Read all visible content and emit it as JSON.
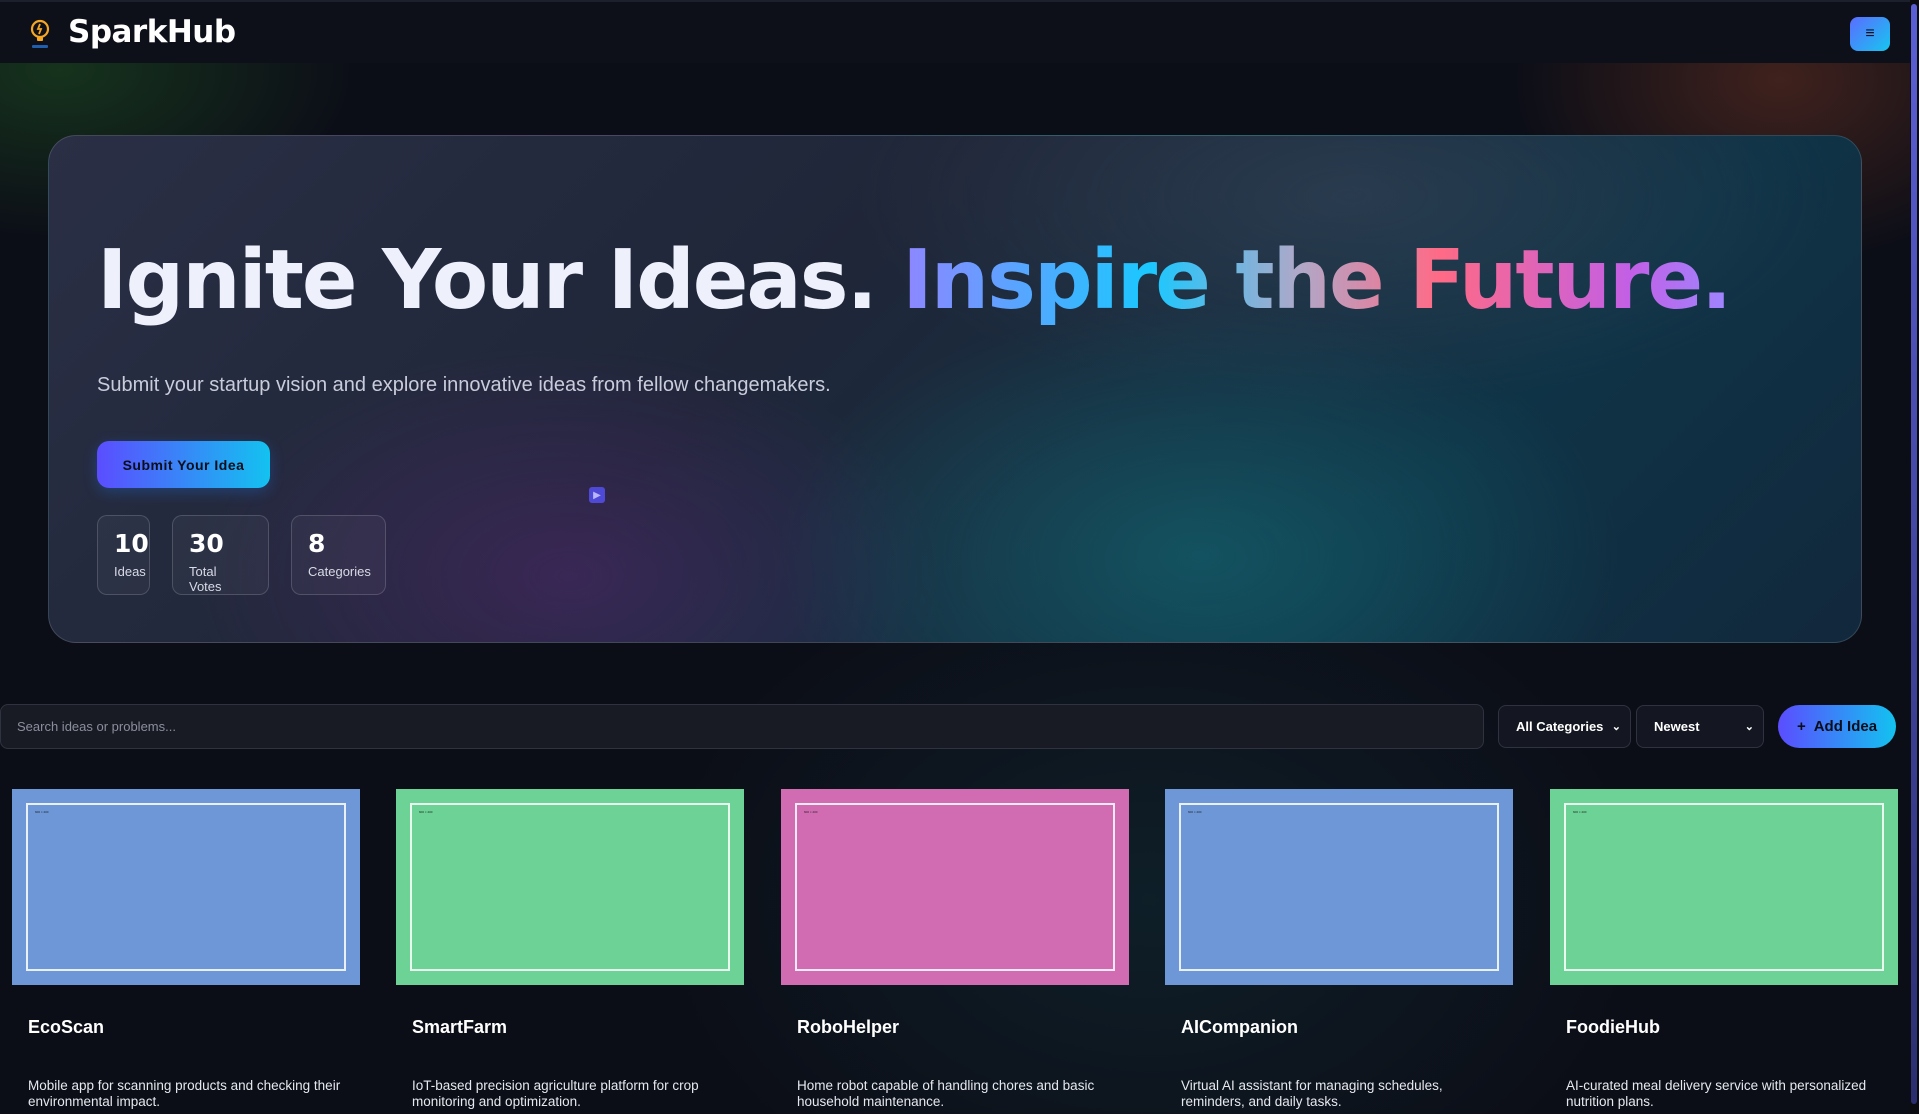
{
  "navbar": {
    "brand": "SparkHub",
    "logo_icon": "lightbulb-icon",
    "menu_icon": "menu-icon",
    "menu_glyph": "≡"
  },
  "hero": {
    "title_plain": "Ignite Your Ideas.",
    "title_gradient": "Inspire the Future.",
    "subtitle": "Submit your startup vision and explore innovative ideas from fellow changemakers.",
    "submit_label": "Submit Your Idea",
    "cursor_icon": "play-icon",
    "stats": [
      {
        "value": "10",
        "label": "Ideas"
      },
      {
        "value": "30",
        "label": "Total Votes"
      },
      {
        "value": "8",
        "label": "Categories"
      }
    ]
  },
  "filters": {
    "search_placeholder": "Search ideas or problems...",
    "category_selected": "All Categories",
    "sort_selected": "Newest",
    "add_label": "Add Idea",
    "add_icon": "plus-icon",
    "add_glyph": "+"
  },
  "ideas": [
    {
      "title": "EcoScan",
      "description": "Mobile app for scanning products and checking their environmental impact.",
      "color": "#6d97d6",
      "thumb_text": "600 × 400"
    },
    {
      "title": "SmartFarm",
      "description": "IoT-based precision agriculture platform for crop monitoring and optimization.",
      "color": "#6dd295",
      "thumb_text": "600 × 400"
    },
    {
      "title": "RoboHelper",
      "description": "Home robot capable of handling chores and basic household maintenance.",
      "color": "#d16cb2",
      "thumb_text": "600 × 400"
    },
    {
      "title": "AICompanion",
      "description": "Virtual AI assistant for managing schedules, reminders, and daily tasks.",
      "color": "#6d97d6",
      "thumb_text": "600 × 400"
    },
    {
      "title": "FoodieHub",
      "description": "AI-curated meal delivery service with personalized nutrition plans.",
      "color": "#6dd295",
      "thumb_text": "600 × 400"
    }
  ],
  "colors": {
    "accent_start": "#5b4dff",
    "accent_end": "#13c2f0",
    "background": "#0c0e17"
  }
}
